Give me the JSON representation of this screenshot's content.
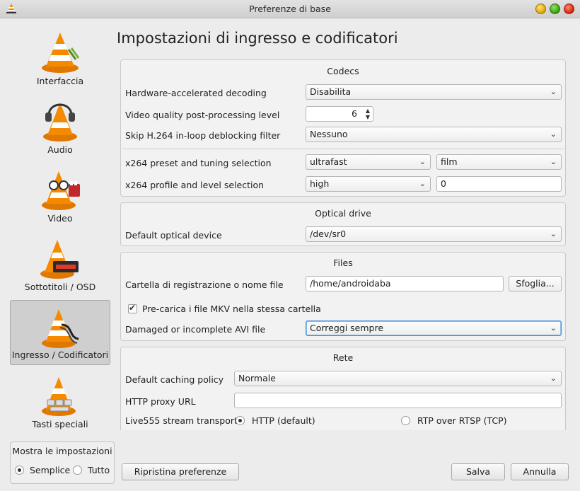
{
  "window": {
    "title": "Preferenze di base"
  },
  "sidebar": {
    "items": [
      {
        "label": "Interfaccia",
        "icon": "vlc-cone-icon"
      },
      {
        "label": "Audio",
        "icon": "headphones-cone-icon"
      },
      {
        "label": "Video",
        "icon": "glasses-cone-icon"
      },
      {
        "label": "Sottotitoli / OSD",
        "icon": "subtitles-cone-icon"
      },
      {
        "label": "Ingresso / Codificatori",
        "icon": "cable-cone-icon"
      },
      {
        "label": "Tasti speciali",
        "icon": "hotkeys-cone-icon"
      }
    ],
    "selected": "Ingresso / Codificatori"
  },
  "show_settings": {
    "title": "Mostra le impostazioni",
    "simple": "Semplice",
    "all": "Tutto",
    "selected": "Semplice"
  },
  "page": {
    "title": "Impostazioni di ingresso e codificatori"
  },
  "codecs": {
    "title": "Codecs",
    "hw_decoding": {
      "label": "Hardware-accelerated decoding",
      "value": "Disabilita"
    },
    "pp_level": {
      "label": "Video quality post-processing level",
      "value": "6"
    },
    "skip_h264": {
      "label": "Skip H.264 in-loop deblocking filter",
      "value": "Nessuno"
    },
    "x264_preset": {
      "label": "x264 preset and tuning selection",
      "preset": "ultrafast",
      "tuning": "film"
    },
    "x264_profile": {
      "label": "x264 profile and level selection",
      "profile": "high",
      "level": "0"
    }
  },
  "optical": {
    "title": "Optical drive",
    "device": {
      "label": "Default optical device",
      "value": "/dev/sr0"
    }
  },
  "files": {
    "title": "Files",
    "record_dir": {
      "label": "Cartella di registrazione o nome file",
      "value": "/home/androidaba",
      "browse": "Sfoglia..."
    },
    "preload_mkv": {
      "label": "Pre-carica i file MKV nella stessa cartella",
      "checked": true
    },
    "avi": {
      "label": "Damaged or incomplete AVI file",
      "value": "Correggi sempre"
    }
  },
  "network": {
    "title": "Rete",
    "caching": {
      "label": "Default caching policy",
      "value": "Normale"
    },
    "proxy": {
      "label": "HTTP proxy URL",
      "value": ""
    },
    "live555": {
      "label": "Live555 stream transport",
      "http": "HTTP (default)",
      "rtsp": "RTP over RTSP (TCP)",
      "selected": "HTTP (default)"
    }
  },
  "buttons": {
    "reset": "Ripristina preferenze",
    "save": "Salva",
    "cancel": "Annulla"
  }
}
